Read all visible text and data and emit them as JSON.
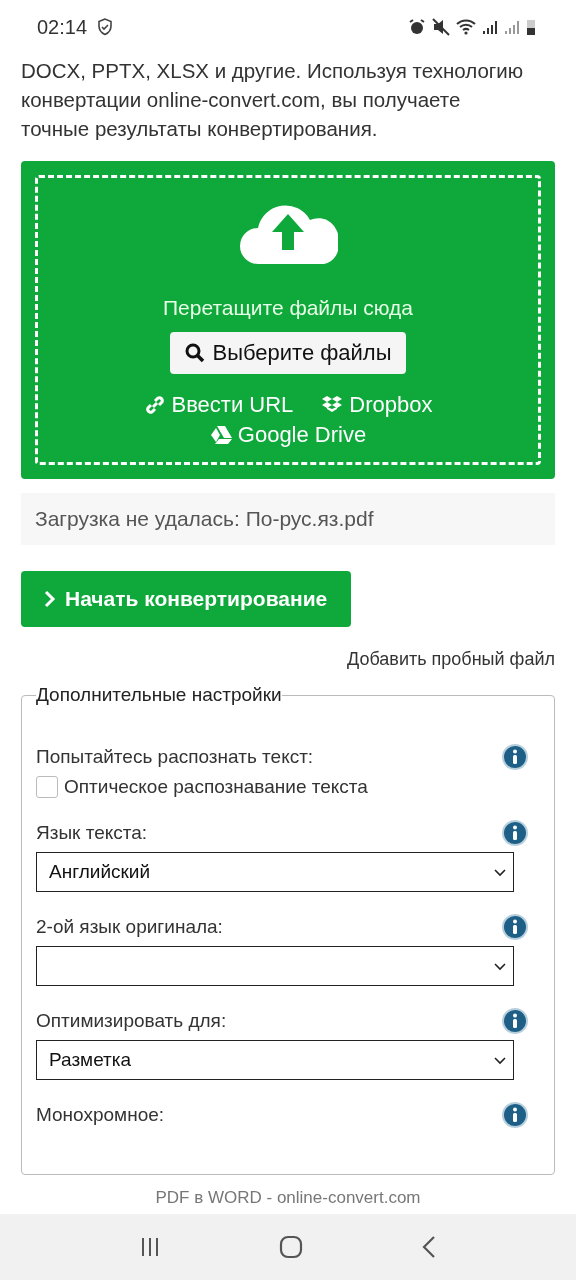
{
  "status_bar": {
    "time": "02:14"
  },
  "intro": [
    "DOCX, PPTX, XLSX и другие. Используя технологию",
    "конвертации online-convert.com, вы получаете",
    "точные результаты конвертирования."
  ],
  "dropzone": {
    "hint": "Перетащите файлы сюда",
    "choose_button": "Выберите файлы",
    "sources": [
      {
        "kind": "url",
        "label": "Ввести URL"
      },
      {
        "kind": "dropbox",
        "label": "Dropbox"
      },
      {
        "kind": "gdrive",
        "label": "Google Drive"
      }
    ]
  },
  "upload_status": "Загрузка не удалась: По-рус.яз.pdf",
  "start_button": "Начать конвертирование",
  "sample_link": "Добавить пробный файл",
  "settings": {
    "legend": "Дополнительные настройки",
    "items": [
      {
        "kind": "checkbox",
        "label": "Попытайтесь распознать текст:",
        "option": "Оптическое распознавание текста",
        "checked": false
      },
      {
        "kind": "select",
        "label": "Язык текста:",
        "value": "Английский"
      },
      {
        "kind": "select",
        "label": "2-ой язык оригинала:"
      },
      {
        "kind": "select",
        "label": "Оптимизировать для:",
        "value": "Разметка"
      },
      {
        "kind": "heading",
        "label": "Монохромное:"
      }
    ]
  },
  "page_title": "PDF в WORD - online-convert.com"
}
